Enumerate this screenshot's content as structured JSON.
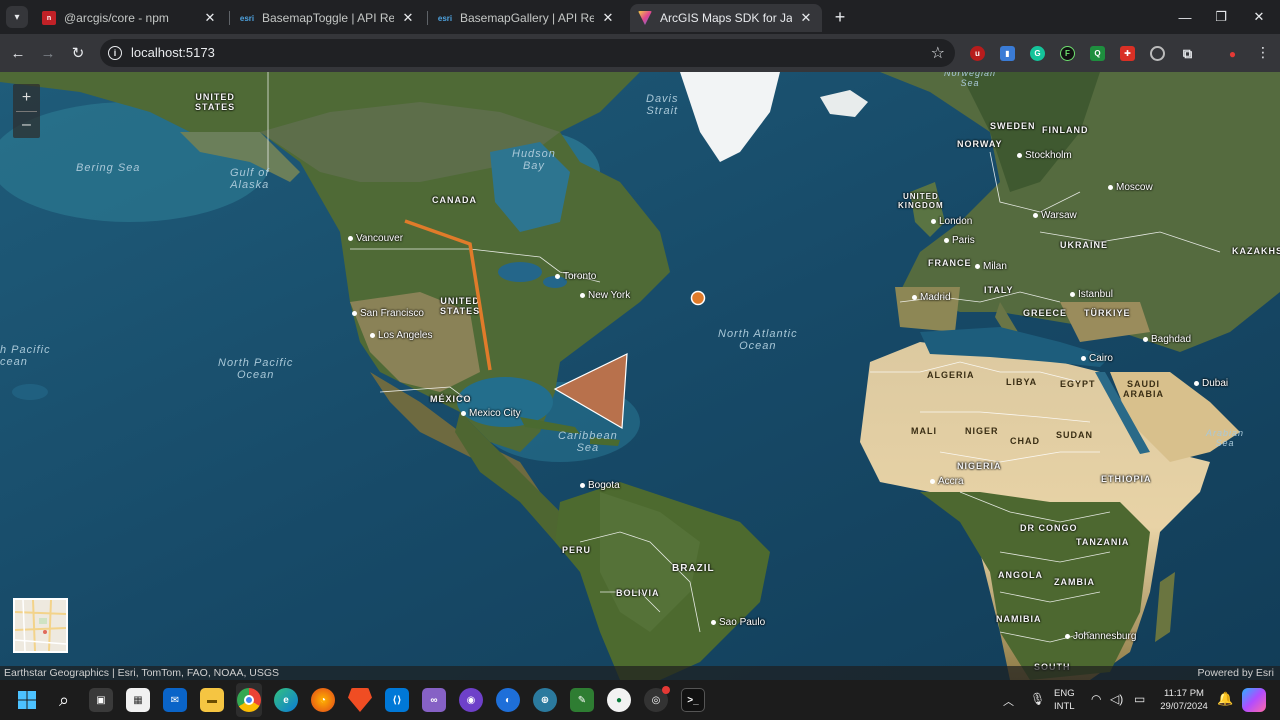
{
  "browser": {
    "tabs": [
      {
        "title": "@arcgis/core - npm",
        "favicon": "npm-icon",
        "active": false
      },
      {
        "title": "BasemapToggle | API Reference",
        "favicon": "esri-icon",
        "active": false
      },
      {
        "title": "BasemapGallery | API Reference",
        "favicon": "esri-icon",
        "active": false
      },
      {
        "title": "ArcGIS Maps SDK for JavaScript",
        "favicon": "arcgis-icon",
        "active": true
      }
    ],
    "url": "localhost:5173"
  },
  "map": {
    "zoom_in": "+",
    "zoom_out": "–",
    "attribution_left": "Earthstar Geographics | Esri, TomTom, FAO, NOAA, USGS",
    "attribution_right": "Powered by Esri",
    "labels": {
      "united_states_top": "UNITED\nSTATES",
      "bering_sea": "Bering Sea",
      "gulf_alaska": "Gulf of\nAlaska",
      "canada": "CANADA",
      "hudson_bay": "Hudson\nBay",
      "davis_strait": "Davis\nStrait",
      "vancouver": "Vancouver",
      "toronto": "Toronto",
      "new_york": "New York",
      "united_states": "UNITED\nSTATES",
      "san_francisco": "San Francisco",
      "los_angeles": "Los Angeles",
      "north_pacific": "North Pacific\nOcean",
      "pacific_left": "h Pacific\ncean",
      "mexico": "MÉXICO",
      "mexico_city": "Mexico City",
      "caribbean": "Caribbean\nSea",
      "north_atlantic": "North Atlantic\nOcean",
      "bogota": "Bogota",
      "peru": "PERU",
      "bolivia": "BOLIVIA",
      "brazil": "BRAZIL",
      "sao_paulo": "Sao Paulo",
      "norwegian_sea": "Norwegian\nSea",
      "sweden": "SWEDEN",
      "finland": "FINLAND",
      "norway": "NORWAY",
      "stockholm": "Stockholm",
      "moscow": "Moscow",
      "united_kingdom": "UNITED\nKINGDOM",
      "london": "London",
      "warsaw": "Warsaw",
      "paris": "Paris",
      "ukraine": "UKRAINE",
      "kazakhstan": "KAZAKHS",
      "france": "FRANCE",
      "milan": "Milan",
      "italy": "ITALY",
      "madrid": "Madrid",
      "istanbul": "Istanbul",
      "greece": "GREECE",
      "turkiye": "TÜRKIYE",
      "baghdad": "Baghdad",
      "cairo": "Cairo",
      "algeria": "ALGERIA",
      "libya": "LIBYA",
      "egypt": "EGYPT",
      "saudi_arabia": "SAUDI\nARABIA",
      "dubai": "Dubai",
      "mali": "MALI",
      "niger": "NIGER",
      "chad": "CHAD",
      "sudan": "SUDAN",
      "arabian_sea": "Arabian\nSea",
      "nigeria": "NIGERIA",
      "accra": "Accra",
      "ethiopia": "ETHIOPIA",
      "dr_congo": "DR CONGO",
      "tanzania": "TANZANIA",
      "angola": "ANGOLA",
      "zambia": "ZAMBIA",
      "namibia": "NAMIBIA",
      "johannesburg": "Johannesburg",
      "south": "SOUTH"
    },
    "graphics": {
      "polyline_color": "#e07b2a",
      "point_color": "#e07b2a",
      "polygon_color": "#b8714c"
    }
  },
  "taskbar": {
    "lang_top": "ENG",
    "lang_bottom": "INTL",
    "time": "11:17 PM",
    "date": "29/07/2024"
  }
}
